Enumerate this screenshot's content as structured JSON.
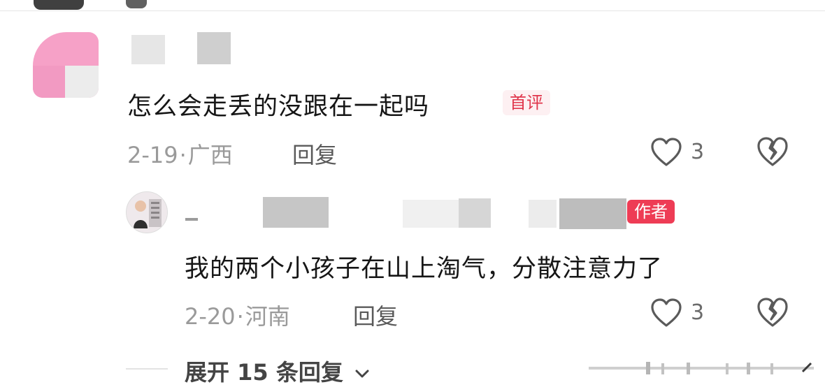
{
  "comment1": {
    "text": "怎么会走丢的没跟在一起吗",
    "badge": "首评",
    "date": "2-19",
    "separator": "·",
    "location": "广西",
    "reply_label": "回复",
    "likes": "3",
    "like_icon": "heart-outline-icon",
    "dislike_icon": "broken-heart-icon"
  },
  "reply1": {
    "text": "我的两个小孩子在山上淘气，分散注意力了",
    "badge": "作者",
    "date": "2-20",
    "separator": "·",
    "location": "河南",
    "reply_label": "回复",
    "likes": "3",
    "like_icon": "heart-outline-icon",
    "dislike_icon": "broken-heart-icon"
  },
  "expand": {
    "label": "展开 15 条回复",
    "icon": "chevron-down-icon"
  },
  "colors": {
    "badge_red": "#ee3c55",
    "badge_first_text": "#e0364c",
    "meta_gray": "#9a9a9a"
  }
}
